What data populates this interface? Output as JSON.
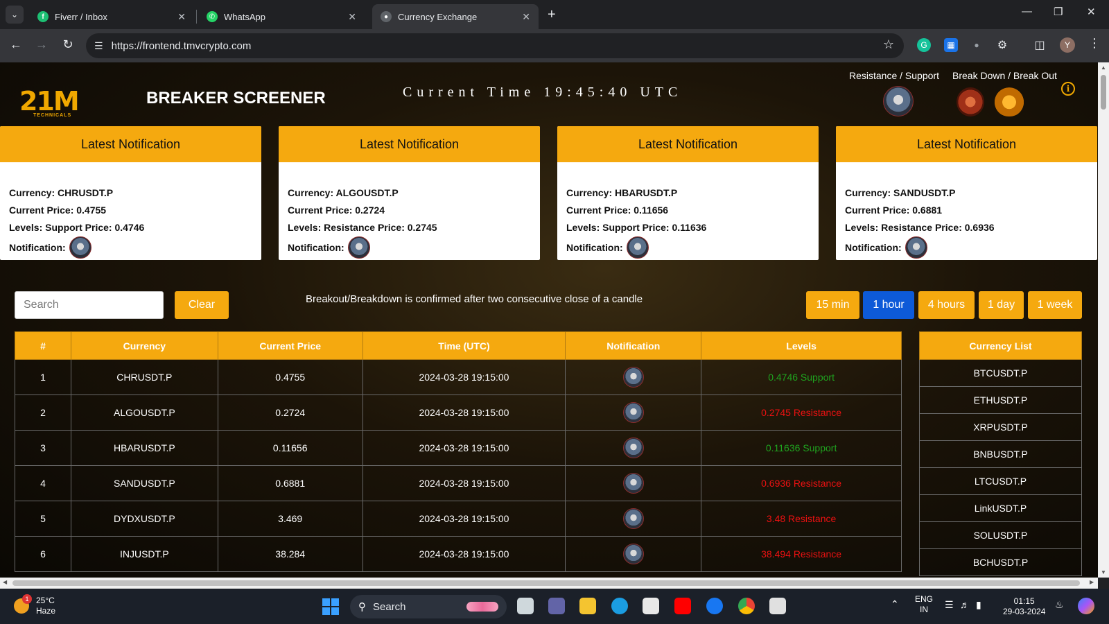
{
  "browser": {
    "tabs": [
      {
        "title": "Fiverr / Inbox",
        "icon": "fiverr-icon",
        "color": "#1dbf73"
      },
      {
        "title": "WhatsApp",
        "icon": "whatsapp-icon",
        "color": "#25d366"
      },
      {
        "title": "Currency Exchange",
        "icon": "globe-icon",
        "color": "#9aa0a6"
      }
    ],
    "url": "https://frontend.tmvcrypto.com"
  },
  "header": {
    "logo_main": "21M",
    "logo_sub": "TECHNICALS",
    "title": "BREAKER SCREENER",
    "clock": "Current Time 19:45:40 UTC",
    "legend_resistance_support": "Resistance / Support",
    "legend_breakdown_breakout": "Break Down / Break Out"
  },
  "cards": [
    {
      "heading": "Latest Notification",
      "currency": "Currency: CHRUSDT.P",
      "price": "Current Price: 0.4755",
      "levels": "Levels: Support Price: 0.4746",
      "notification_label": "Notification:"
    },
    {
      "heading": "Latest Notification",
      "currency": "Currency: ALGOUSDT.P",
      "price": "Current Price: 0.2724",
      "levels": "Levels: Resistance Price: 0.2745",
      "notification_label": "Notification:"
    },
    {
      "heading": "Latest Notification",
      "currency": "Currency: HBARUSDT.P",
      "price": "Current Price: 0.11656",
      "levels": "Levels: Support Price: 0.11636",
      "notification_label": "Notification:"
    },
    {
      "heading": "Latest Notification",
      "currency": "Currency: SANDUSDT.P",
      "price": "Current Price: 0.6881",
      "levels": "Levels: Resistance Price: 0.6936",
      "notification_label": "Notification:"
    }
  ],
  "controls": {
    "search_placeholder": "Search",
    "clear_label": "Clear",
    "note": "Breakout/Breakdown is confirmed after two consecutive close of a candle",
    "timeframes": [
      "15 min",
      "1 hour",
      "4 hours",
      "1 day",
      "1 week"
    ],
    "active_timeframe": "1 hour"
  },
  "table": {
    "headers": [
      "#",
      "Currency",
      "Current Price",
      "Time (UTC)",
      "Notification",
      "Levels"
    ],
    "rows": [
      {
        "n": "1",
        "currency": "CHRUSDT.P",
        "price": "0.4755",
        "time": "2024-03-28 19:15:00",
        "level": "0.4746 Support",
        "type": "support"
      },
      {
        "n": "2",
        "currency": "ALGOUSDT.P",
        "price": "0.2724",
        "time": "2024-03-28 19:15:00",
        "level": "0.2745 Resistance",
        "type": "resistance"
      },
      {
        "n": "3",
        "currency": "HBARUSDT.P",
        "price": "0.11656",
        "time": "2024-03-28 19:15:00",
        "level": "0.11636 Support",
        "type": "support"
      },
      {
        "n": "4",
        "currency": "SANDUSDT.P",
        "price": "0.6881",
        "time": "2024-03-28 19:15:00",
        "level": "0.6936 Resistance",
        "type": "resistance"
      },
      {
        "n": "5",
        "currency": "DYDXUSDT.P",
        "price": "3.469",
        "time": "2024-03-28 19:15:00",
        "level": "3.48 Resistance",
        "type": "resistance"
      },
      {
        "n": "6",
        "currency": "INJUSDT.P",
        "price": "38.284",
        "time": "2024-03-28 19:15:00",
        "level": "38.494 Resistance",
        "type": "resistance"
      }
    ]
  },
  "currency_list": {
    "header": "Currency List",
    "items": [
      "BTCUSDT.P",
      "ETHUSDT.P",
      "XRPUSDT.P",
      "BNBUSDT.P",
      "LTCUSDT.P",
      "LinkUSDT.P",
      "SOLUSDT.P",
      "BCHUSDT.P"
    ]
  },
  "colors": {
    "accent": "#f5a90f",
    "active_button": "#0d5ad8",
    "support": "#1fa31f",
    "resistance": "#ee1111"
  },
  "taskbar": {
    "weather_temp": "25°C",
    "weather_desc": "Haze",
    "weather_badge": "1",
    "search_label": "Search",
    "lang_top": "ENG",
    "lang_bottom": "IN",
    "time": "01:15",
    "date": "29-03-2024"
  }
}
